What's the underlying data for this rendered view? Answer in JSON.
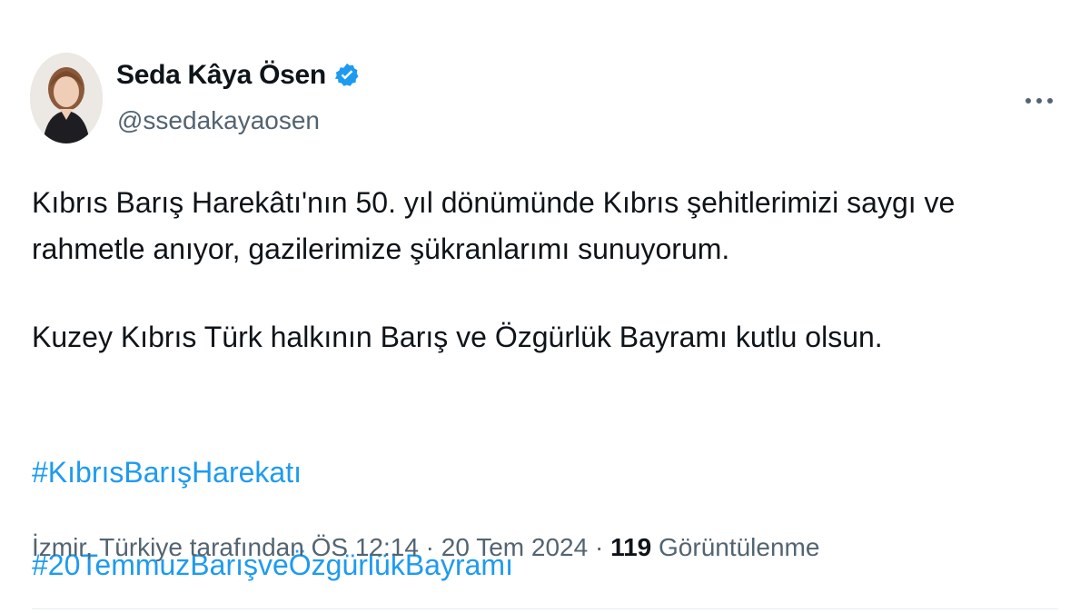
{
  "author": {
    "name": "Seda Kâya Ösen",
    "handle": "@ssedakayaosen",
    "verified": true,
    "verified_color": "#1d9bf0"
  },
  "menu": {
    "icon": "more-horizontal-icon"
  },
  "tweet": {
    "paragraph_1": "Kıbrıs Barış Harekâtı'nın 50. yıl dönümünde Kıbrıs şehitlerimizi saygı ve\nrahmetle anıyor, gazilerimize şükranlarımı sunuyorum.",
    "paragraph_2": "Kuzey Kıbrıs Türk halkının Barış ve Özgürlük Bayramı kutlu olsun.",
    "hashtags": [
      "#KıbrısBarışHarekatı",
      "#20TemmuzBarışveÖzgürlükBayramı"
    ]
  },
  "meta": {
    "location_time": "İzmir, Türkiye tarafından ÖS 12:14 · 20 Tem 2024 · ",
    "views_count": "119",
    "views_label": " Görüntülenme"
  },
  "colors": {
    "text": "#0f1419",
    "secondary": "#536471",
    "link": "#1d9bf0"
  }
}
